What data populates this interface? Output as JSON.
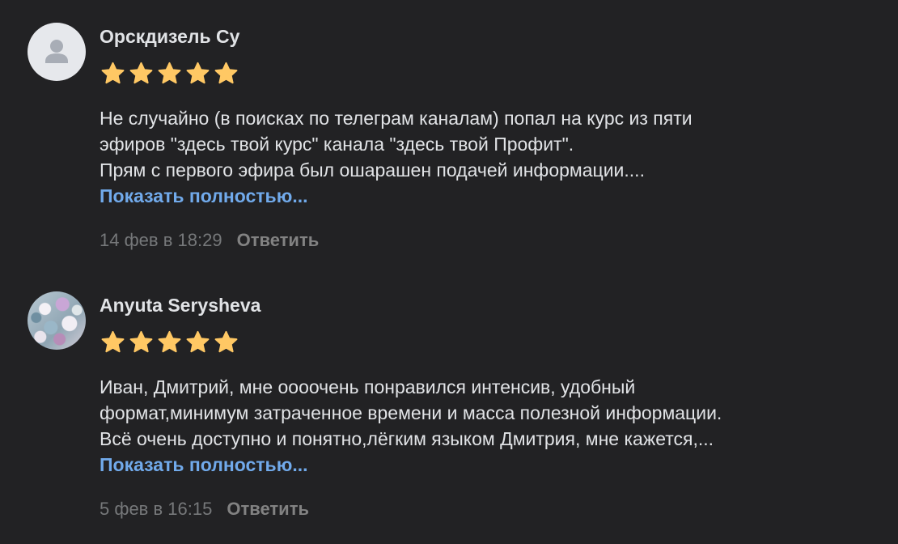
{
  "reviews": [
    {
      "author": "Орскдизель Су",
      "avatar": "placeholder-user-icon",
      "rating": 5,
      "text_lines": [
        "Не случайно (в поисках по телеграм каналам) попал на курс из пяти",
        "эфиров \"здесь твой курс\" канала \"здесь твой Профит\".",
        "Прям с первого эфира был ошарашен подачей информации...."
      ],
      "show_more": "Показать полностью...",
      "date": "14 фев в 18:29",
      "reply": "Ответить"
    },
    {
      "author": "Anyuta Serysheva",
      "avatar": "photo-flowers",
      "rating": 5,
      "text_lines": [
        "Иван, Дмитрий, мне оооочень понравился интенсив, удобный",
        "формат,минимум затраченное времени и масса полезной информации.",
        "Всё очень доступно и понятно,лёгким языком Дмитрия, мне кажется,..."
      ],
      "show_more": "Показать полностью...",
      "date": "5 фев в 16:15",
      "reply": "Ответить"
    }
  ],
  "colors": {
    "background": "#222224",
    "star": "#ffc864",
    "link": "#71aaeb",
    "muted": "#76787a"
  }
}
